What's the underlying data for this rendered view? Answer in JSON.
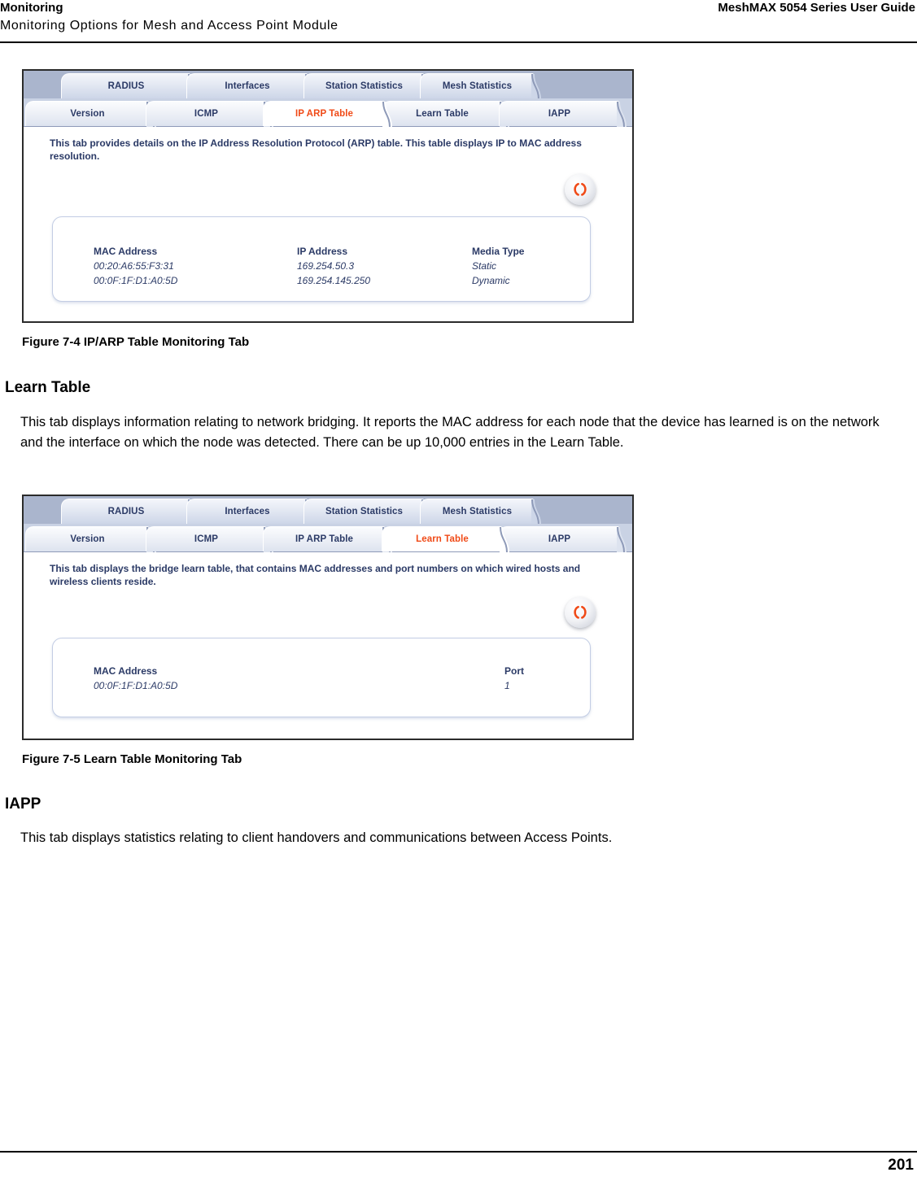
{
  "header": {
    "left_title": "Monitoring",
    "right_title": "MeshMAX 5054 Series User Guide",
    "subtitle": "Monitoring Options for Mesh and Access Point Module"
  },
  "figure_1": {
    "caption": "Figure 7-4 IP/ARP Table Monitoring Tab",
    "tabs_top": [
      {
        "label": "RADIUS",
        "active": false
      },
      {
        "label": "Interfaces",
        "active": false
      },
      {
        "label": "Station Statistics",
        "active": false
      },
      {
        "label": "Mesh Statistics",
        "active": false
      }
    ],
    "tabs_bottom": [
      {
        "label": "Version",
        "active": false
      },
      {
        "label": "ICMP",
        "active": false
      },
      {
        "label": "IP ARP Table",
        "active": true
      },
      {
        "label": "Learn Table",
        "active": false
      },
      {
        "label": "IAPP",
        "active": false
      }
    ],
    "description": "This tab provides details on the IP Address Resolution Protocol (ARP) table. This table displays IP to MAC address resolution.",
    "refresh_icon": "refresh-icon",
    "table": {
      "columns": [
        "MAC Address",
        "IP Address",
        "Media Type"
      ],
      "rows": [
        [
          "00:20:A6:55:F3:31",
          "169.254.50.3",
          "Static"
        ],
        [
          "00:0F:1F:D1:A0:5D",
          "169.254.145.250",
          "Dynamic"
        ]
      ]
    }
  },
  "figure_2": {
    "caption": "Figure 7-5 Learn Table Monitoring Tab",
    "tabs_top": [
      {
        "label": "RADIUS",
        "active": false
      },
      {
        "label": "Interfaces",
        "active": false
      },
      {
        "label": "Station Statistics",
        "active": false
      },
      {
        "label": "Mesh Statistics",
        "active": false
      }
    ],
    "tabs_bottom": [
      {
        "label": "Version",
        "active": false
      },
      {
        "label": "ICMP",
        "active": false
      },
      {
        "label": "IP ARP Table",
        "active": false
      },
      {
        "label": "Learn Table",
        "active": true
      },
      {
        "label": "IAPP",
        "active": false
      }
    ],
    "description": "This tab displays the bridge learn table, that contains MAC addresses and port numbers on which wired hosts and wireless clients reside.",
    "refresh_icon": "refresh-icon",
    "table": {
      "columns": [
        "MAC Address",
        "Port"
      ],
      "rows": [
        [
          "00:0F:1F:D1:A0:5D",
          "1"
        ]
      ]
    }
  },
  "sections": {
    "learn_table_heading": "Learn Table",
    "learn_table_para": "This tab displays information relating to network bridging. It reports the MAC address for each node that the device has learned is on the network and the interface on which the node was detected. There can be up 10,000 entries in the Learn Table.",
    "iapp_heading": "IAPP",
    "iapp_para": "This tab displays statistics relating to client handovers and communications between Access Points."
  },
  "footer": {
    "page_number": "201"
  },
  "colors": {
    "tab_active_text": "#f04a17",
    "tab_text": "#2b3a66",
    "tab_strip_top_bg": "#aab5cd",
    "tab_strip_bottom_bg": "#c9d2e4",
    "refresh_icon": "#f04a17"
  }
}
